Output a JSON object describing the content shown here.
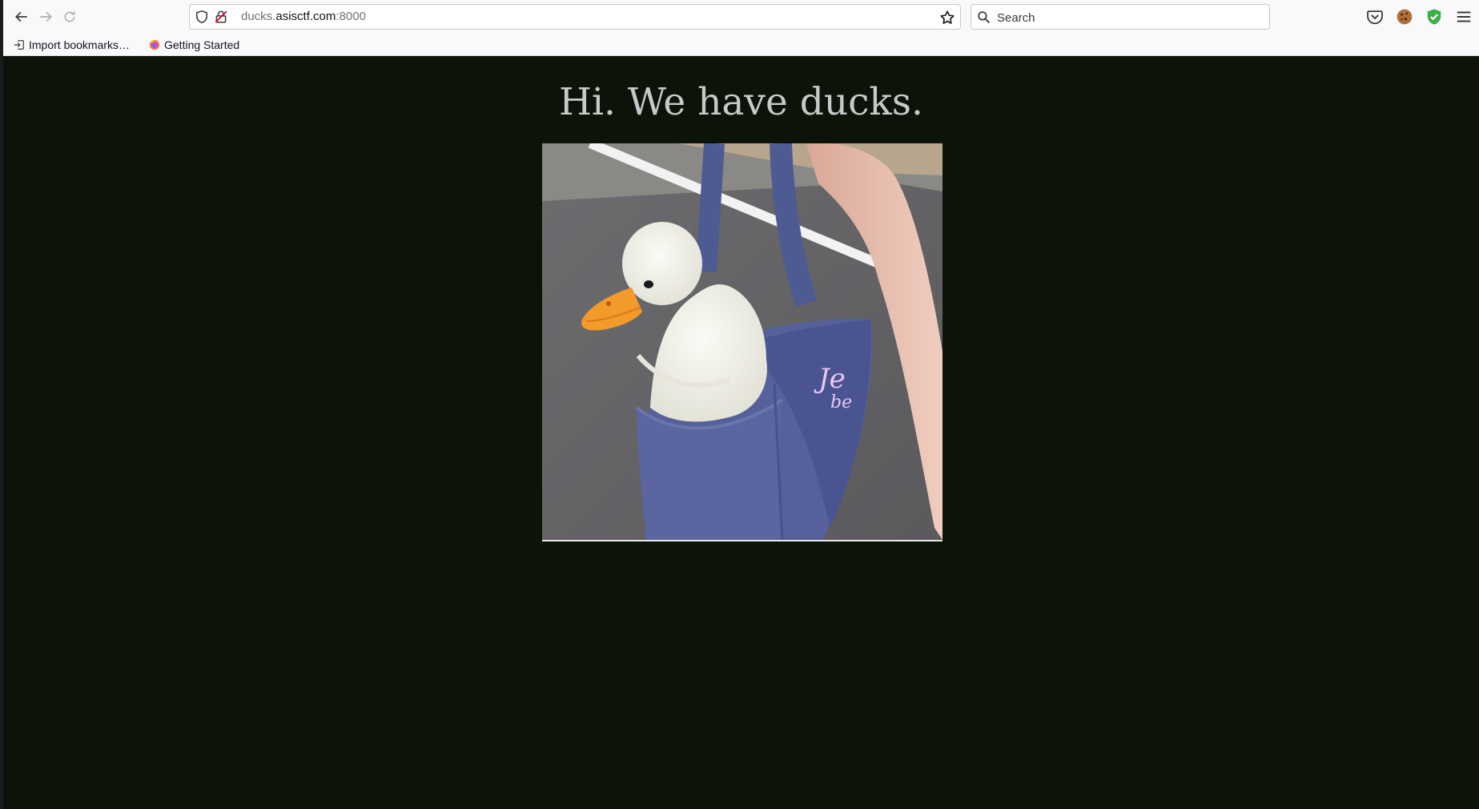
{
  "browser": {
    "url_host_prefix": "ducks.",
    "url_host": "asisctf.com",
    "url_port": ":8000",
    "search_placeholder": "Search"
  },
  "bookmarks": [
    {
      "label": "Import bookmarks…",
      "icon": "import-icon"
    },
    {
      "label": "Getting Started",
      "icon": "firefox-icon"
    }
  ],
  "page": {
    "heading": "Hi. We have ducks.",
    "image_alt": "duck-in-tote-bag-photo",
    "background_color": "#0c140a",
    "heading_color": "#c9c9c9"
  },
  "photo": {
    "bag_text": [
      "Je",
      "be"
    ]
  }
}
